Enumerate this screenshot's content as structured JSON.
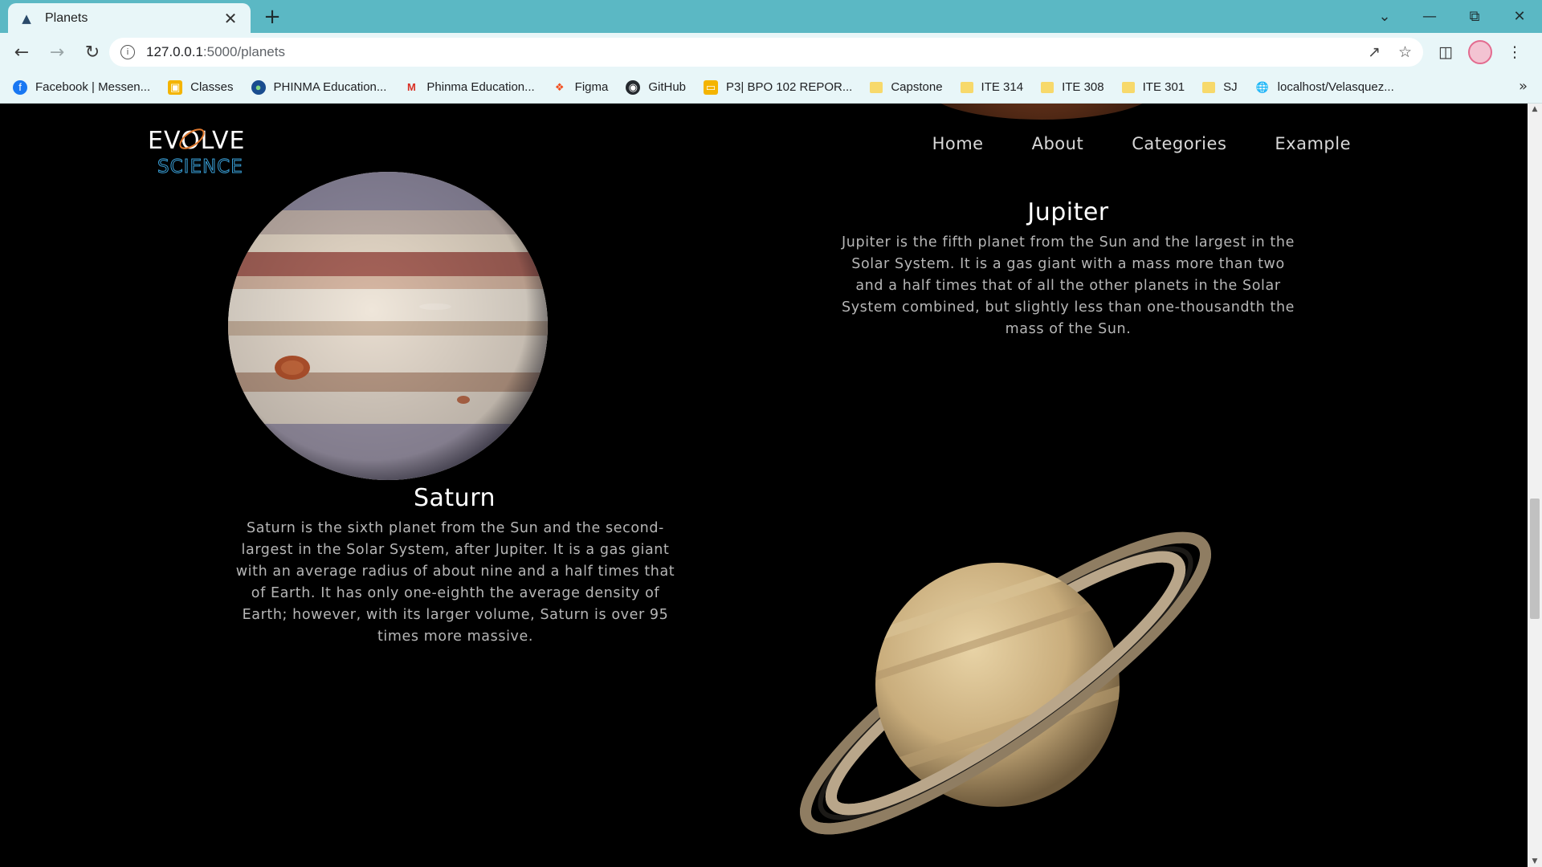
{
  "browser": {
    "tab_title": "Planets",
    "url_host": "127.0.0.1",
    "url_rest": ":5000/planets",
    "bookmarks": [
      {
        "label": "Facebook | Messen...",
        "icon": "facebook-icon"
      },
      {
        "label": "Classes",
        "icon": "classroom-icon"
      },
      {
        "label": "PHINMA Education...",
        "icon": "globe-icon"
      },
      {
        "label": "Phinma Education...",
        "icon": "gmail-icon"
      },
      {
        "label": "Figma",
        "icon": "figma-icon"
      },
      {
        "label": "GitHub",
        "icon": "github-icon"
      },
      {
        "label": "P3| BPO 102 REPOR...",
        "icon": "slides-icon"
      },
      {
        "label": "Capstone",
        "icon": "folder-icon"
      },
      {
        "label": "ITE 314",
        "icon": "folder-icon"
      },
      {
        "label": "ITE 308",
        "icon": "folder-icon"
      },
      {
        "label": "ITE 301",
        "icon": "folder-icon"
      },
      {
        "label": "SJ",
        "icon": "folder-icon"
      },
      {
        "label": "localhost/Velasquez...",
        "icon": "globe-icon"
      }
    ]
  },
  "site": {
    "logo_top": "EVOLVE",
    "logo_bottom": "SCIENCE",
    "nav": [
      "Home",
      "About",
      "Categories",
      "Example"
    ]
  },
  "planets": {
    "jupiter": {
      "title": "Jupiter",
      "description": "Jupiter is the fifth planet from the Sun and the largest in the Solar System. It is a gas giant with a mass more than two and a half times that of all the other planets in the Solar System combined, but slightly less than one-thousandth the mass of the Sun."
    },
    "saturn": {
      "title": "Saturn",
      "description": "Saturn is the sixth planet from the Sun and the second-largest in the Solar System, after Jupiter. It is a gas giant with an average radius of about nine and a half times that of Earth. It has only one-eighth the average density of Earth; however, with its larger volume, Saturn is over 95 times more massive."
    }
  },
  "colors": {
    "chrome_tab_bar": "#5bb8c4",
    "chrome_toolbar": "#e8f6f8",
    "page_background": "#000000",
    "logo_accent": "#e0792e",
    "logo_blue": "#3aa0d8"
  }
}
